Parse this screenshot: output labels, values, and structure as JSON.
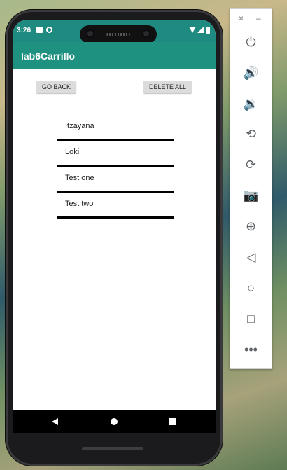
{
  "status_bar": {
    "time": "3:26"
  },
  "app_bar": {
    "title": "lab6Carrillo"
  },
  "buttons": {
    "go_back": "GO BACK",
    "delete_all": "DELETE ALL"
  },
  "list_items": [
    "Itzayana",
    "Loki",
    "Test one",
    "Test two"
  ],
  "emulator_panel": {
    "close": "×",
    "minimize": "–",
    "icons": [
      "power-icon",
      "volume-up-icon",
      "volume-down-icon",
      "rotate-left-icon",
      "rotate-right-icon",
      "camera-icon",
      "zoom-icon",
      "back-icon",
      "home-icon",
      "overview-icon",
      "more-icon"
    ]
  },
  "colors": {
    "status_bar": "#1f8a7f",
    "app_bar": "#1f9181"
  }
}
